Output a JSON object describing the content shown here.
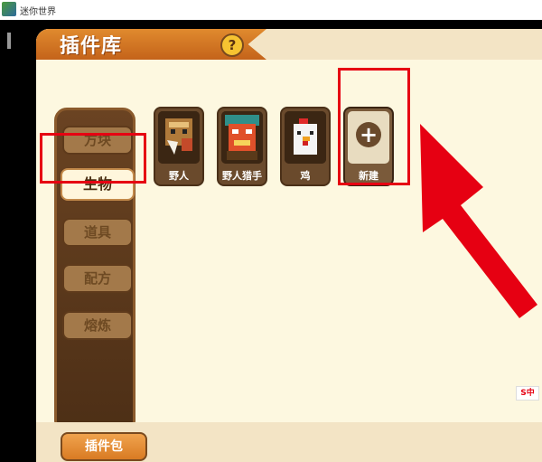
{
  "window": {
    "title": "迷你世界"
  },
  "panel": {
    "title": "插件库",
    "help_label": "?"
  },
  "sidebar": {
    "tabs": [
      {
        "label": "方块",
        "active": false
      },
      {
        "label": "生物",
        "active": true
      },
      {
        "label": "道具",
        "active": false
      },
      {
        "label": "配方",
        "active": false
      },
      {
        "label": "熔炼",
        "active": false
      }
    ]
  },
  "items": [
    {
      "label": "野人",
      "icon": "savage-icon"
    },
    {
      "label": "野人猎手",
      "icon": "savage-hunter-icon"
    },
    {
      "label": "鸡",
      "icon": "chicken-icon"
    },
    {
      "label": "新建",
      "icon": "plus-icon"
    }
  ],
  "footer": {
    "pack_label": "插件包"
  },
  "ime": {
    "label": "S中"
  },
  "colors": {
    "highlight": "#e60012",
    "brand_orange": "#e08a2e",
    "panel_bg": "#fcf7de"
  }
}
